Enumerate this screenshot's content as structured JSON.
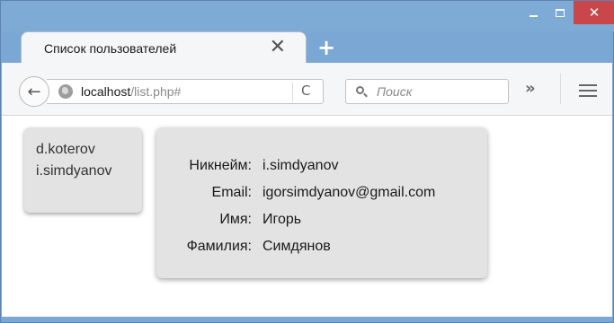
{
  "window": {
    "minimize_icon": "minimize-icon",
    "maximize_icon": "maximize-icon",
    "close_glyph": "✕"
  },
  "tab": {
    "title": "Список пользователей",
    "close_glyph": "✕",
    "new_tab_glyph": "+"
  },
  "toolbar": {
    "back_glyph": "←",
    "url_host": "localhost",
    "url_path": "/list.php#",
    "reload_glyph": "C",
    "search_placeholder": "Поиск",
    "overflow_glyph": "»"
  },
  "users": [
    {
      "login": "d.koterov"
    },
    {
      "login": "i.simdyanov"
    }
  ],
  "details": [
    {
      "label": "Никнейм:",
      "value": "i.simdyanov"
    },
    {
      "label": "Email:",
      "value": "igorsimdyanov@gmail.com"
    },
    {
      "label": "Имя:",
      "value": "Игорь"
    },
    {
      "label": "Фамилия:",
      "value": "Симдянов"
    }
  ],
  "colors": {
    "frame": "#7ba7d4",
    "close_button": "#c9464a",
    "card_background": "#e3e3e3"
  }
}
